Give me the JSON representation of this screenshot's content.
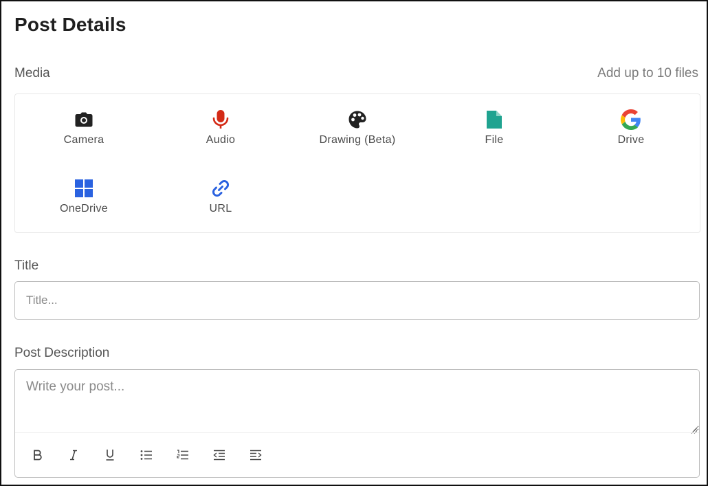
{
  "page": {
    "title": "Post Details"
  },
  "media": {
    "label": "Media",
    "hint": "Add up to 10 files",
    "items": [
      {
        "label": "Camera",
        "icon": "camera-icon",
        "color": "#222222"
      },
      {
        "label": "Audio",
        "icon": "microphone-icon",
        "color": "#d42a16"
      },
      {
        "label": "Drawing (Beta)",
        "icon": "palette-icon",
        "color": "#222222"
      },
      {
        "label": "File",
        "icon": "file-icon",
        "color": "#1fa390"
      },
      {
        "label": "Drive",
        "icon": "google-icon",
        "color": "#4285f4"
      },
      {
        "label": "OneDrive",
        "icon": "windows-icon",
        "color": "#2a62e0"
      },
      {
        "label": "URL",
        "icon": "link-icon",
        "color": "#2a62e0"
      }
    ]
  },
  "title_field": {
    "label": "Title",
    "placeholder": "Title..."
  },
  "description": {
    "label": "Post Description",
    "placeholder": "Write your post...",
    "toolbar": [
      "bold-icon",
      "italic-icon",
      "underline-icon",
      "bullet-list-icon",
      "numbered-list-icon",
      "outdent-icon",
      "indent-icon"
    ]
  }
}
